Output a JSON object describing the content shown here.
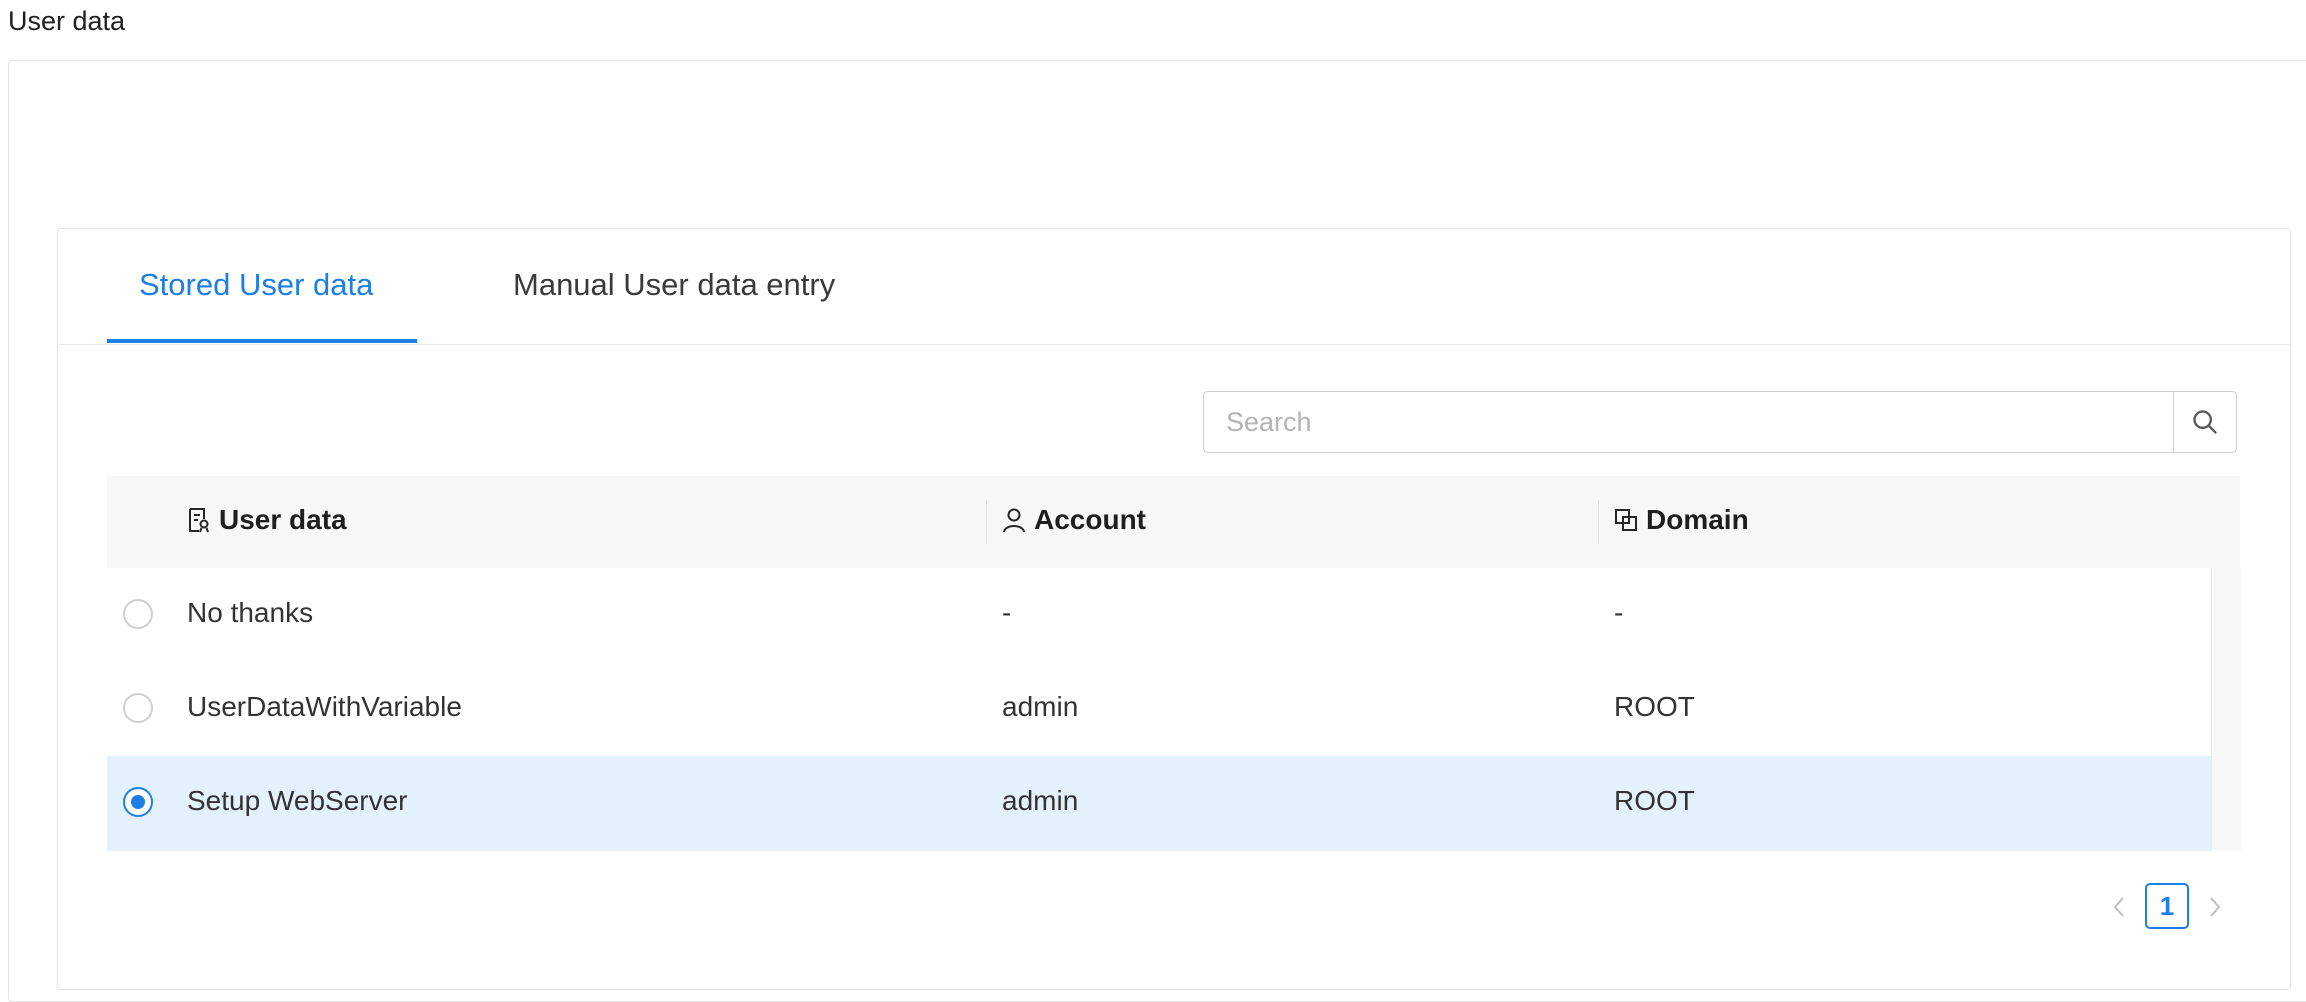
{
  "section": {
    "title": "User data"
  },
  "tabs": [
    {
      "label": "Stored User data",
      "active": true
    },
    {
      "label": "Manual User data entry",
      "active": false
    }
  ],
  "search": {
    "placeholder": "Search",
    "value": ""
  },
  "table": {
    "columns": [
      {
        "label": "User data",
        "icon": "file-text-icon"
      },
      {
        "label": "Account",
        "icon": "user-icon"
      },
      {
        "label": "Domain",
        "icon": "block-icon"
      }
    ],
    "rows": [
      {
        "name": "No thanks",
        "account": "-",
        "domain": "-",
        "selected": false
      },
      {
        "name": "UserDataWithVariable",
        "account": "admin",
        "domain": "ROOT",
        "selected": false
      },
      {
        "name": "Setup WebServer",
        "account": "admin",
        "domain": "ROOT",
        "selected": true
      }
    ]
  },
  "pagination": {
    "current_page": "1"
  },
  "colors": {
    "accent": "#1b7fe3",
    "selected_row": "#e3f1fd",
    "header_bg": "#f7f7f7"
  }
}
